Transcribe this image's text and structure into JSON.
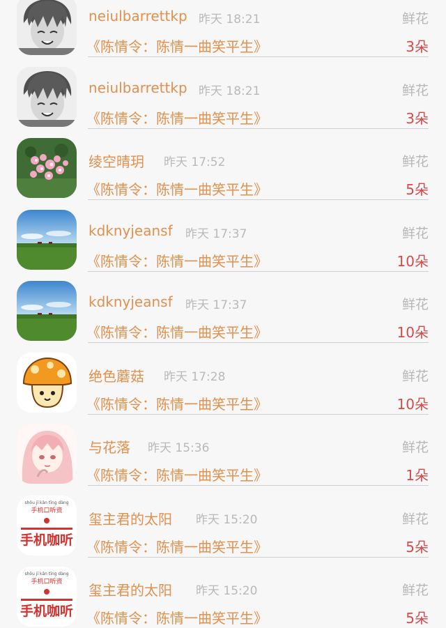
{
  "items": [
    {
      "username": "neiulbarrettkp",
      "time": "昨天 18:21",
      "gift_type": "鲜花",
      "book_title": "《陈情令：陈情一曲笑平生》",
      "count": "3朵",
      "avatar_icon": "anime-boy-grayscale-avatar"
    },
    {
      "username": "neiulbarrettkp",
      "time": "昨天 18:21",
      "gift_type": "鲜花",
      "book_title": "《陈情令：陈情一曲笑平生》",
      "count": "3朵",
      "avatar_icon": "anime-boy-grayscale-avatar"
    },
    {
      "username": "绫空晴玥",
      "time": "昨天 17:52",
      "gift_type": "鲜花",
      "book_title": "《陈情令：陈情一曲笑平生》",
      "count": "5朵",
      "avatar_icon": "pink-blossom-avatar"
    },
    {
      "username": "kdknyjeansf",
      "time": "昨天 17:37",
      "gift_type": "鲜花",
      "book_title": "《陈情令：陈情一曲笑平生》",
      "count": "10朵",
      "avatar_icon": "green-meadow-avatar"
    },
    {
      "username": "kdknyjeansf",
      "time": "昨天 17:37",
      "gift_type": "鲜花",
      "book_title": "《陈情令：陈情一曲笑平生》",
      "count": "10朵",
      "avatar_icon": "green-meadow-avatar"
    },
    {
      "username": "绝色蘑菇",
      "time": "昨天 17:28",
      "gift_type": "鲜花",
      "book_title": "《陈情令：陈情一曲笑平生》",
      "count": "10朵",
      "avatar_icon": "orange-mushroom-avatar"
    },
    {
      "username": "与花落",
      "time": "昨天 15:36",
      "gift_type": "鲜花",
      "book_title": "《陈情令：陈情一曲笑平生》",
      "count": "1朵",
      "avatar_icon": "anime-girl-pink-avatar"
    },
    {
      "username": "玺主君的太阳",
      "time": "昨天 15:20",
      "gift_type": "鲜花",
      "book_title": "《陈情令：陈情一曲笑平生》",
      "count": "5朵",
      "avatar_icon": "phone-listen-logo-avatar"
    },
    {
      "username": "玺主君的太阳",
      "time": "昨天 15:20",
      "gift_type": "鲜花",
      "book_title": "《陈情令：陈情一曲笑平生》",
      "count": "5朵",
      "avatar_icon": "phone-listen-logo-avatar"
    }
  ],
  "logo": {
    "pinyin": "shǒu jī kǎn tīng dàng",
    "small_text": "手机口听资",
    "big_text": "手机咖听"
  },
  "colors": {
    "username": "#e2904e",
    "book_title": "#e2904e",
    "count": "#d54a4a",
    "muted": "#b9b9b9",
    "divider": "#cfcfcf"
  }
}
